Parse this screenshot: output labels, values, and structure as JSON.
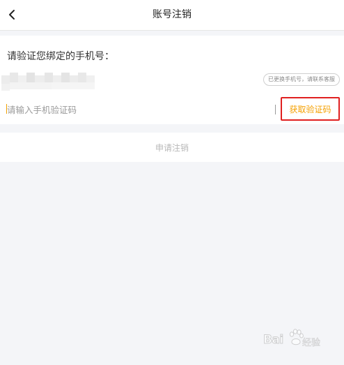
{
  "header": {
    "title": "账号注销",
    "back_icon": "chevron-left-icon"
  },
  "verify": {
    "prompt": "请验证您绑定的手机号：",
    "phone_changed_link": "已更换手机号，请联系客服",
    "code_input": {
      "value": "",
      "placeholder": "请输入手机验证码"
    },
    "get_code_label": "获取验证码"
  },
  "submit": {
    "label": "申请注销"
  },
  "watermark": {
    "brand": "Bai",
    "suffix": "经验"
  },
  "colors": {
    "accent": "#f5a000",
    "highlight_border": "#e02020",
    "disabled_text": "#b8b8b8",
    "page_background": "#f4f5f8"
  }
}
